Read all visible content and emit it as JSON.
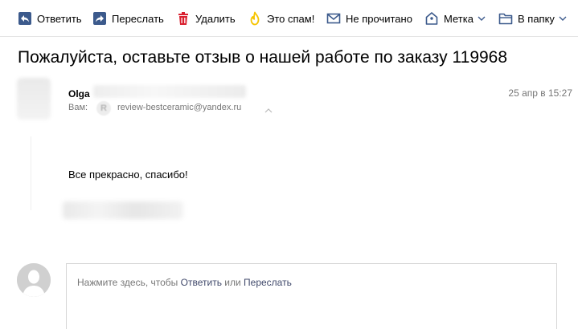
{
  "toolbar": {
    "items": [
      {
        "label": "Ответить",
        "icon": "reply-icon"
      },
      {
        "label": "Переслать",
        "icon": "forward-icon"
      },
      {
        "label": "Удалить",
        "icon": "trash-icon"
      },
      {
        "label": "Это спам!",
        "icon": "spam-flame-icon"
      },
      {
        "label": "Не прочитано",
        "icon": "envelope-icon"
      },
      {
        "label": "Метка",
        "icon": "label-tag-icon"
      },
      {
        "label": "В папку",
        "icon": "folder-icon"
      }
    ]
  },
  "message": {
    "subject": "Пожалуйста, оставьте отзыв о нашей работе по заказу 119968",
    "sender_name": "Olga",
    "to_label": "Вам:",
    "to_badge": "R",
    "to_email": "review-bestceramic@yandex.ru",
    "date": "25 апр в 15:27",
    "body": "Все прекрасно, спасибо!"
  },
  "reply": {
    "hint_prefix": "Нажмите здесь, чтобы ",
    "reply_link": "Ответить",
    "hint_middle": " или ",
    "forward_link": "Переслать"
  },
  "colors": {
    "icon_blue": "#3c5a8c",
    "delete_red": "#d9202f",
    "spam_yellow": "#f6c400",
    "muted_text": "#777777",
    "link": "#40496b"
  }
}
